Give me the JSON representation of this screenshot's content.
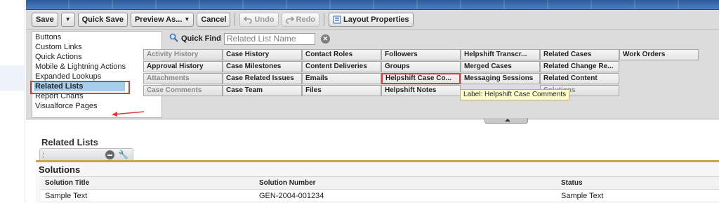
{
  "toolbar": {
    "save": "Save",
    "quick_save": "Quick Save",
    "preview_as": "Preview As...",
    "cancel": "Cancel",
    "undo": "Undo",
    "redo": "Redo",
    "layout_properties": "Layout Properties"
  },
  "categories": [
    "Buttons",
    "Custom Links",
    "Quick Actions",
    "Mobile & Lightning Actions",
    "Expanded Lookups",
    "Related Lists",
    "Report Charts",
    "Visualforce Pages"
  ],
  "selected_category": "Related Lists",
  "quick_find": {
    "label": "Quick Find",
    "placeholder": "Related List Name"
  },
  "palette_items": [
    [
      "Activity History",
      "Case History",
      "Contact Roles",
      "Followers",
      "Helpshift Transcr...",
      "Related Cases",
      "Work Orders"
    ],
    [
      "Approval History",
      "Case Milestones",
      "Content Deliveries",
      "Groups",
      "Merged Cases",
      "Related Change Re..."
    ],
    [
      "Attachments",
      "Case Related Issues",
      "Emails",
      "Helpshift Case Co...",
      "Messaging Sessions",
      "Related Content"
    ],
    [
      "Case Comments",
      "Case Team",
      "Files",
      "Helpshift Notes",
      "",
      "Solutions"
    ]
  ],
  "used_items": [
    "Activity History",
    "Attachments",
    "Case Comments",
    "Solutions"
  ],
  "tooltip": "Label: Helpshift Case Comments",
  "section": {
    "title": "Related Lists"
  },
  "related_list": {
    "name": "Solutions",
    "columns": [
      "Solution Title",
      "Solution Number",
      "Status"
    ],
    "rows": [
      [
        "Sample Text",
        "GEN-2004-001234",
        "Sample Text"
      ]
    ]
  },
  "colors": {
    "accent_red": "#e03a3a",
    "selection_blue": "#a6cdea",
    "tooltip_bg": "#ffffd2",
    "section_rule": "#c9a642"
  }
}
